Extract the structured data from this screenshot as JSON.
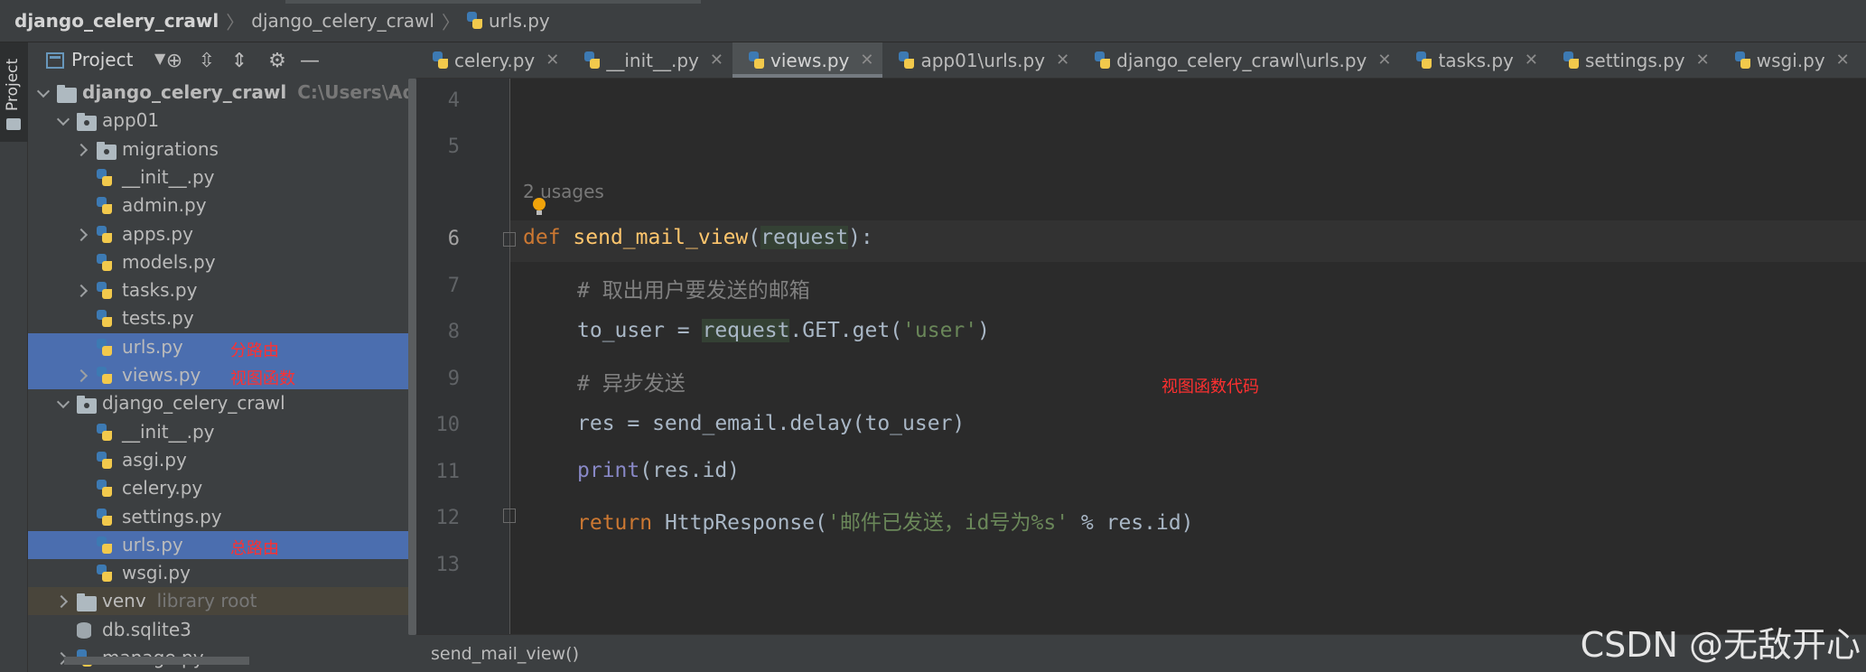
{
  "breadcrumb": {
    "items": [
      "django_celery_crawl",
      "django_celery_crawl",
      "urls.py"
    ]
  },
  "toolstrip": {
    "project_label": "Project"
  },
  "project_panel": {
    "title": "Project",
    "tree": [
      {
        "label": "django_celery_crawl",
        "hint": "C:\\Users\\Admin",
        "type": "root-folder",
        "depth": 0,
        "arrow": "down"
      },
      {
        "label": "app01",
        "type": "pkg-folder",
        "depth": 1,
        "arrow": "down"
      },
      {
        "label": "migrations",
        "type": "pkg-folder",
        "depth": 2,
        "arrow": "right"
      },
      {
        "label": "__init__.py",
        "type": "py",
        "depth": 2,
        "arrow": "none"
      },
      {
        "label": "admin.py",
        "type": "py",
        "depth": 2,
        "arrow": "none"
      },
      {
        "label": "apps.py",
        "type": "py",
        "depth": 2,
        "arrow": "right"
      },
      {
        "label": "models.py",
        "type": "py",
        "depth": 2,
        "arrow": "none"
      },
      {
        "label": "tasks.py",
        "type": "py",
        "depth": 2,
        "arrow": "right"
      },
      {
        "label": "tests.py",
        "type": "py",
        "depth": 2,
        "arrow": "none"
      },
      {
        "label": "urls.py",
        "type": "py",
        "depth": 2,
        "arrow": "none",
        "selected": true,
        "annotation": "分路由"
      },
      {
        "label": "views.py",
        "type": "py",
        "depth": 2,
        "arrow": "right",
        "selected": true,
        "annotation": "视图函数"
      },
      {
        "label": "django_celery_crawl",
        "type": "pkg-folder",
        "depth": 1,
        "arrow": "down"
      },
      {
        "label": "__init__.py",
        "type": "py",
        "depth": 2,
        "arrow": "none"
      },
      {
        "label": "asgi.py",
        "type": "py",
        "depth": 2,
        "arrow": "none"
      },
      {
        "label": "celery.py",
        "type": "py",
        "depth": 2,
        "arrow": "none"
      },
      {
        "label": "settings.py",
        "type": "py",
        "depth": 2,
        "arrow": "none"
      },
      {
        "label": "urls.py",
        "type": "py",
        "depth": 2,
        "arrow": "none",
        "selected": true,
        "annotation": "总路由"
      },
      {
        "label": "wsgi.py",
        "type": "py",
        "depth": 2,
        "arrow": "none"
      },
      {
        "label": "venv",
        "hint": "library root",
        "type": "folder",
        "depth": 1,
        "arrow": "right",
        "venv": true
      },
      {
        "label": "db.sqlite3",
        "type": "db",
        "depth": 1,
        "arrow": "none"
      },
      {
        "label": "manage.py",
        "type": "py",
        "depth": 1,
        "arrow": "right"
      }
    ]
  },
  "tabs": [
    {
      "label": "celery.py",
      "active": false
    },
    {
      "label": "__init__.py",
      "active": false
    },
    {
      "label": "views.py",
      "active": true
    },
    {
      "label": "app01\\urls.py",
      "active": false
    },
    {
      "label": "django_celery_crawl\\urls.py",
      "active": false
    },
    {
      "label": "tasks.py",
      "active": false
    },
    {
      "label": "settings.py",
      "active": false
    },
    {
      "label": "wsgi.py",
      "active": false
    }
  ],
  "editor": {
    "usages": "2 usages",
    "annotation": "视图函数代码",
    "line_numbers": [
      "4",
      "5",
      "6",
      "7",
      "8",
      "9",
      "10",
      "11",
      "12",
      "13"
    ],
    "current_line": "6",
    "code": {
      "l6_def": "def",
      "l6_name": "send_mail_view",
      "l6_open": "(",
      "l6_param": "request",
      "l6_close": "):",
      "l7": "# 取出用户要发送的邮箱",
      "l8_a": "to_user = ",
      "l8_req": "request",
      "l8_b": ".GET.get(",
      "l8_str": "'user'",
      "l8_c": ")",
      "l9": "# 异步发送",
      "l10": "res = send_email.delay(to_user)",
      "l11_print": "print",
      "l11_rest": "(res.id)",
      "l12_ret": "return",
      "l12_a": " HttpResponse(",
      "l12_str": "'邮件已发送，id号为%s'",
      "l12_b": " % res.id)"
    }
  },
  "bottom_bar": {
    "function_crumb": "send_mail_view()"
  },
  "watermark": "CSDN @无敌开心"
}
